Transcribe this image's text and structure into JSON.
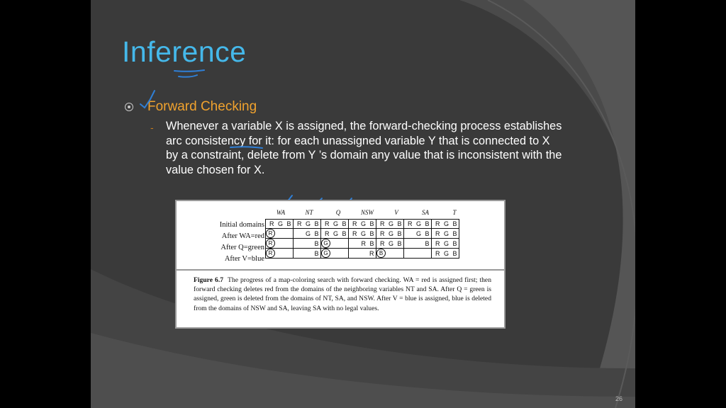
{
  "slide": {
    "title": "Inference",
    "heading": "Forward Checking",
    "body": "Whenever a variable X is assigned, the forward-checking process establishes arc consistency for it: for each unassigned variable Y that is connected to X by a constraint, delete from Y ’s domain any value that is inconsistent with the value chosen for X.",
    "page_number": "26"
  },
  "figure": {
    "columns": [
      "WA",
      "NT",
      "Q",
      "NSW",
      "V",
      "SA",
      "T"
    ],
    "rows": [
      {
        "label": "Initial domains",
        "cells": [
          "R G B",
          "R G B",
          "R G B",
          "R G B",
          "R G B",
          "R G B",
          "R G B"
        ]
      },
      {
        "label": "After WA=red",
        "cells": [
          "(R)",
          "G B",
          "R G B",
          "R G B",
          "R G B",
          "G B",
          "R G B"
        ]
      },
      {
        "label": "After Q=green",
        "cells": [
          "(R)",
          "B",
          "(G)",
          "R   B",
          "R G B",
          "B",
          "R G B"
        ]
      },
      {
        "label": "After V=blue",
        "cells": [
          "(R)",
          "B",
          "(G)",
          "R",
          "(B)",
          "",
          "R G B"
        ]
      }
    ],
    "caption_label": "Figure 6.7",
    "caption": "The progress of a map-coloring search with forward checking. WA = red is assigned first; then forward checking deletes red from the domains of the neighboring variables NT and SA. After Q = green is assigned, green is deleted from the domains of NT, SA, and NSW. After V = blue is assigned, blue is deleted from the domains of NSW and SA, leaving SA with no legal values."
  },
  "colors": {
    "title": "#45b8ea",
    "heading": "#f0a22e",
    "background": "#3a3a3a",
    "ink_annotation": "#2f7fd6"
  },
  "icons": {
    "bullet": "radio-bullet-icon",
    "annotations": "handwritten-checkmark-icon"
  }
}
